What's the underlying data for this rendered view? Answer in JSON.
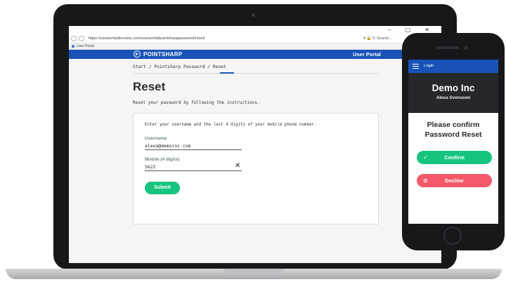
{
  "browser": {
    "url": "https://userportaldemoinc.com/userportal/pointsharppassword/reset/",
    "addr_right": "▾ 🔒 ↻   Search...",
    "tab_title": "User Portal",
    "window_controls": "–  ▢  ✕"
  },
  "app": {
    "brand": "POINTSHARP",
    "portal_label": "User Portal",
    "breadcrumb": "Start  /  Pointsharp Password  /  Reset",
    "title": "Reset",
    "instructions": "Reset your password by following the instructions.",
    "card_intro": "Enter your username and the last 4 digits of your mobile phone number.",
    "username_label": "Username",
    "username_value": "alexa@demoinc.com",
    "mobile_label": "Mobile (4 digits)",
    "mobile_value": "5622",
    "clear_symbol": "✕",
    "submit_label": "Submit"
  },
  "phone": {
    "nav_label": "Login",
    "company": "Demo Inc",
    "user": "Alexa Svensson",
    "confirm_title_line1": "Please confirm",
    "confirm_title_line2": "Password Reset",
    "confirm_label": "Confirm",
    "confirm_icon": "✓",
    "decline_label": "Decline",
    "decline_icon": "⊘"
  },
  "colors": {
    "brand_blue": "#1953b8",
    "confirm_green": "#17c47e",
    "decline_red": "#f4596a",
    "dark_header": "#25272b"
  }
}
